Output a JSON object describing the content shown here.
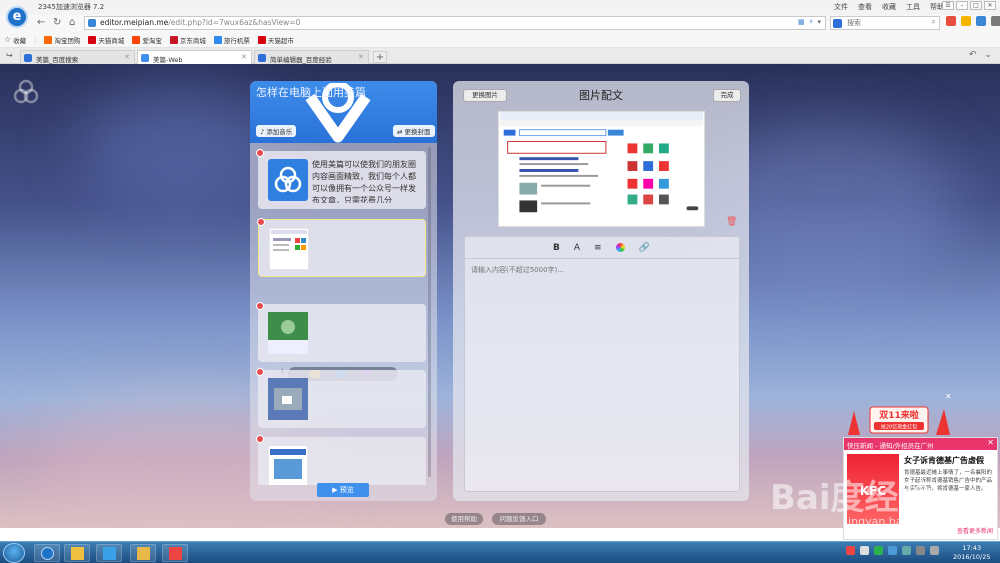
{
  "browser": {
    "app_title": "2345加速浏览器 7.2",
    "menu": [
      "文件",
      "查看",
      "收藏",
      "工具",
      "帮助"
    ],
    "url_host": "editor.meipian.me",
    "url_path": "/edit.php?id=7wux6az&hasView=0",
    "search_placeholder": "搜索"
  },
  "bookmarks": [
    {
      "label": "收藏",
      "icon": "star-icon",
      "color": "#888888"
    },
    {
      "label": "淘宝团购",
      "icon": "taobao-icon",
      "color": "#ff6a00"
    },
    {
      "label": "天猫商城",
      "icon": "tmall-icon",
      "color": "#d6000f"
    },
    {
      "label": "爱淘宝",
      "icon": "aitaobao-icon",
      "color": "#ff4400"
    },
    {
      "label": "京东商城",
      "icon": "jd-icon",
      "color": "#c91623"
    },
    {
      "label": "旅行机票",
      "icon": "travel-icon",
      "color": "#2d8cf0"
    },
    {
      "label": "天猫超市",
      "icon": "tmall-market-icon",
      "color": "#d6000f"
    }
  ],
  "tabs": [
    {
      "label": "美篇_百度搜索",
      "active": false,
      "color": "#2d6ed8"
    },
    {
      "label": "美篇-Web",
      "active": true,
      "color": "#3e90ec"
    },
    {
      "label": "简单编辑器_百度经验",
      "active": false,
      "color": "#2d6ed8"
    }
  ],
  "editor": {
    "cover_title": "怎样在电脑上面用美篇",
    "add_music": "添加音乐",
    "change_cover": "更换封面",
    "first_card_text": "使用美篇可以使我们的朋友圈内容画面精致，我们每个人都可以像拥有一个公众号一样发布文章，只需花费几分",
    "preview": "预览",
    "right_title": "图片配文",
    "change_image": "更换图片",
    "done": "完成",
    "text_placeholder": "请输入内容(不超过5000字)...",
    "toolbar": [
      "B",
      "A",
      "≡"
    ],
    "help": "使用帮助",
    "feedback": "问题反馈入口"
  },
  "popup": {
    "banner": "双11来啦",
    "banner_sub": "抢20亿现金红包",
    "header": "快压新闻 - 通知/外招员在广州",
    "headline": "女子诉肯德基广告虚假",
    "body": "肯德基最近摊上事情了，一名襄阳的女子起诉称肯德基销售广告中的产品与实际不符，将肯德基一家人告。",
    "more": "查看更多新闻",
    "img_text": "KFC"
  },
  "watermark": {
    "main": "Bai度经验",
    "sub": "jingyan.baidu.com"
  },
  "taskbar": {
    "time": "17:43",
    "date": "2016/10/25"
  }
}
